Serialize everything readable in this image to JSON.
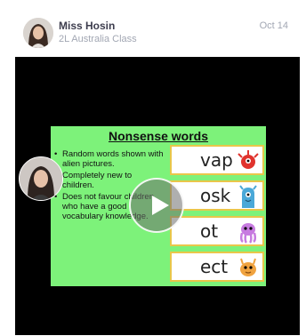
{
  "post": {
    "author": "Miss Hosin",
    "class_name": "2L Australia Class",
    "date": "Oct 14"
  },
  "slide": {
    "title": "Nonsense words",
    "bullets": [
      "Random words shown with alien pictures.",
      "Completely new to children.",
      "Does not favour children who have a good vocabulary knowledge."
    ],
    "words": [
      {
        "text": "vap",
        "alien": "red-alien-icon"
      },
      {
        "text": "osk",
        "alien": "blue-alien-icon"
      },
      {
        "text": "ot",
        "alien": "purple-octopus-alien-icon"
      },
      {
        "text": "ect",
        "alien": "orange-alien-icon"
      }
    ]
  },
  "colors": {
    "slide_background": "#7df27a",
    "word_card_border": "#e9c64a",
    "video_background": "#000000"
  }
}
